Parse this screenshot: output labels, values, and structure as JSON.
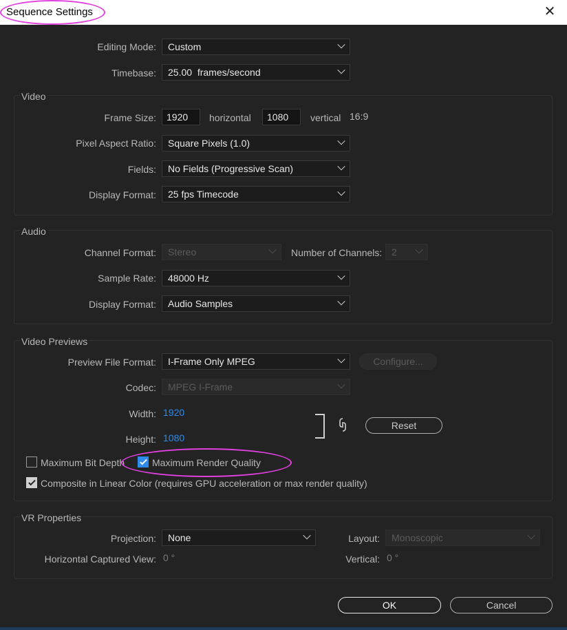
{
  "window": {
    "title": "Sequence Settings",
    "close_glyph": "✕"
  },
  "general": {
    "editing_mode_label": "Editing Mode:",
    "editing_mode_value": "Custom",
    "timebase_label": "Timebase:",
    "timebase_value": "25.00  frames/second"
  },
  "video": {
    "group_title": "Video",
    "frame_size_label": "Frame Size:",
    "frame_width": "1920",
    "horizontal_label": "horizontal",
    "frame_height": "1080",
    "vertical_label": "vertical",
    "aspect": "16:9",
    "pixel_aspect_label": "Pixel Aspect Ratio:",
    "pixel_aspect_value": "Square Pixels (1.0)",
    "fields_label": "Fields:",
    "fields_value": "No Fields (Progressive Scan)",
    "display_format_label": "Display Format:",
    "display_format_value": "25 fps Timecode"
  },
  "audio": {
    "group_title": "Audio",
    "channel_format_label": "Channel Format:",
    "channel_format_value": "Stereo",
    "num_channels_label": "Number of Channels:",
    "num_channels_value": "2",
    "sample_rate_label": "Sample Rate:",
    "sample_rate_value": "48000 Hz",
    "display_format_label": "Display Format:",
    "display_format_value": "Audio Samples"
  },
  "previews": {
    "group_title": "Video Previews",
    "file_format_label": "Preview File Format:",
    "file_format_value": "I-Frame Only MPEG",
    "configure_label": "Configure...",
    "codec_label": "Codec:",
    "codec_value": "MPEG I-Frame",
    "width_label": "Width:",
    "width_value": "1920",
    "height_label": "Height:",
    "height_value": "1080",
    "reset_label": "Reset",
    "max_bit_depth_label": "Maximum Bit Depth",
    "max_render_quality_label": "Maximum Render Quality",
    "composite_label": "Composite in Linear Color (requires GPU acceleration or max render quality)"
  },
  "vr": {
    "group_title": "VR Properties",
    "projection_label": "Projection:",
    "projection_value": "None",
    "layout_label": "Layout:",
    "layout_value": "Monoscopic",
    "h_captured_label": "Horizontal Captured View:",
    "h_captured_value": "0 °",
    "vertical_label": "Vertical:",
    "vertical_value": "0 °"
  },
  "footer": {
    "ok_label": "OK",
    "cancel_label": "Cancel"
  },
  "colors": {
    "accent": "#2d8ceb",
    "annotation": "#e040e0",
    "background": "#232323"
  }
}
